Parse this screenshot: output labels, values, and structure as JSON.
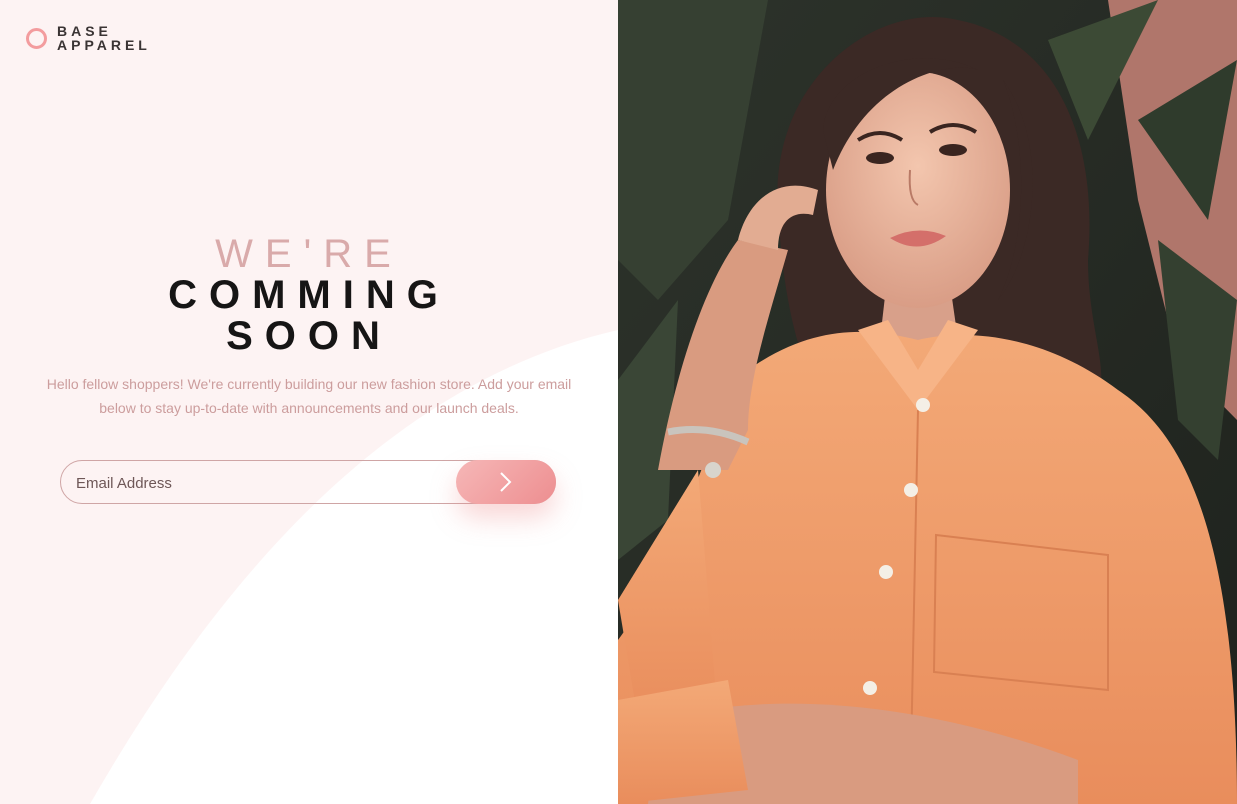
{
  "brand": {
    "line1": "BASE",
    "line2": "APPAREL",
    "accent_color": "#f39c9e",
    "logo_icon": "ring-logo-icon"
  },
  "hero": {
    "title_light": "WE'RE",
    "title_dark_line1": "COMMING",
    "title_dark_line2": "SOON",
    "description": "Hello fellow shoppers! We're currently building our new fashion store. Add your email below to stay up-to-date with announcements and our launch deals."
  },
  "signup": {
    "email_placeholder": "Email Address",
    "email_value": "",
    "submit_icon": "chevron-right-icon",
    "button_gradient": [
      "#f6b7b7",
      "#ed8e90"
    ]
  },
  "photo": {
    "subject": "hero-photo",
    "shirt_color": "#f1a070"
  }
}
